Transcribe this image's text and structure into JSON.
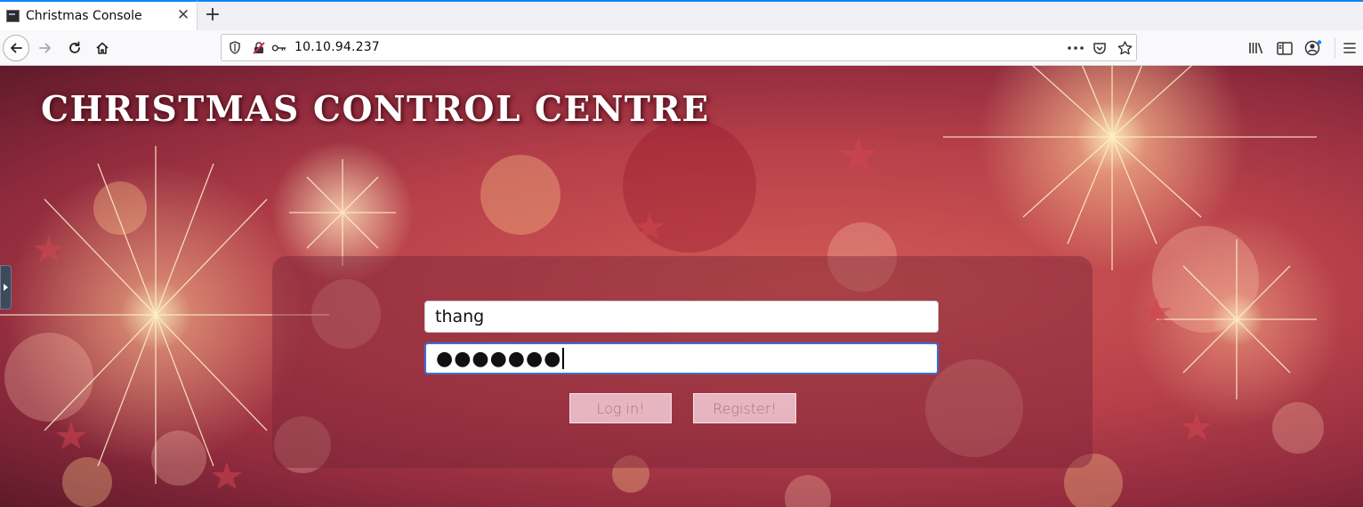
{
  "browser": {
    "tab": {
      "title": "Christmas Console",
      "favicon": "terminal-icon"
    },
    "url": "10.10.94.237",
    "icons": {
      "back": "back-arrow-icon",
      "forward": "forward-arrow-icon",
      "reload": "reload-icon",
      "home": "home-icon",
      "tracking": "shield-icon",
      "insecure": "insecure-lock-icon",
      "permissions": "key-icon",
      "page_actions": "more-icon",
      "pocket": "pocket-icon",
      "bookmark": "star-icon",
      "library": "library-icon",
      "sidebar": "sidebar-icon",
      "account": "account-icon",
      "menu": "hamburger-menu-icon"
    },
    "accent_color": "#0a84ff"
  },
  "page": {
    "title": "CHRISTMAS CONTROL CENTRE",
    "login": {
      "username_value": "thang",
      "password_value": "●●●●●●●",
      "login_button": "Log in!",
      "register_button": "Register!"
    }
  }
}
